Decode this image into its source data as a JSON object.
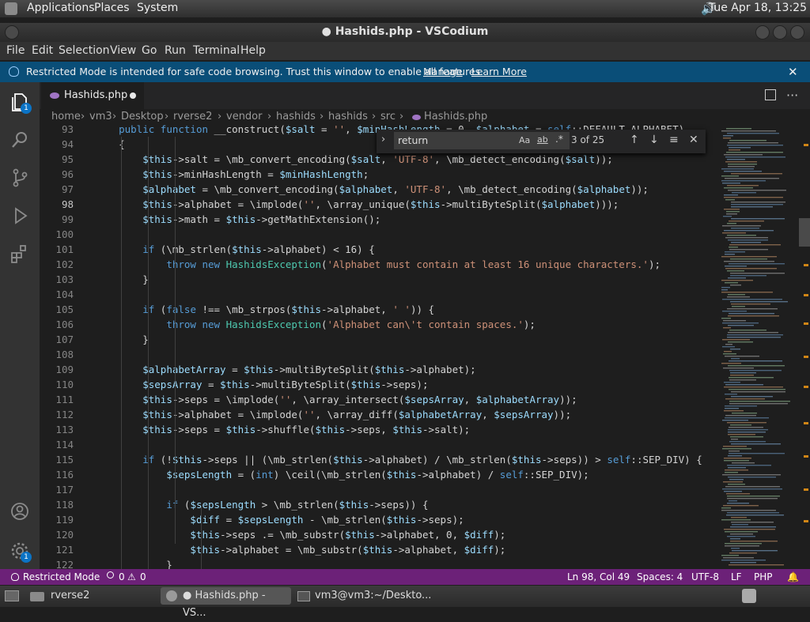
{
  "panel": {
    "applications": "Applications",
    "places": "Places",
    "system": "System",
    "clock": "Tue Apr 18, 13:25"
  },
  "window": {
    "title": "● Hashids.php - VSCodium"
  },
  "menu": [
    "File",
    "Edit",
    "Selection",
    "View",
    "Go",
    "Run",
    "Terminal",
    "Help"
  ],
  "banner": {
    "text": "Restricted Mode is intended for safe code browsing. Trust this window to enable all features.",
    "manage": "Manage",
    "learn_more": "Learn More"
  },
  "tab": {
    "label": "Hashids.php"
  },
  "breadcrumb": [
    "home",
    "vm3",
    "Desktop",
    "rverse2",
    "vendor",
    "hashids",
    "hashids",
    "src",
    "Hashids.php"
  ],
  "find": {
    "value": "return",
    "count": "3 of 25",
    "case": "Aa",
    "word": "ab",
    "regex": ".*"
  },
  "activity_badges": {
    "explorer": "1",
    "settings": "1"
  },
  "code_lines": [
    {
      "n": "93",
      "t": "    public function __construct($salt = '', $minHashLength = 0, $alphabet = self::DEFAULT_ALPHABET)"
    },
    {
      "n": "94",
      "t": "    {"
    },
    {
      "n": "95",
      "t": "        $this->salt = \\mb_convert_encoding($salt, 'UTF-8', \\mb_detect_encoding($salt));"
    },
    {
      "n": "96",
      "t": "        $this->minHashLength = $minHashLength;"
    },
    {
      "n": "97",
      "t": "        $alphabet = \\mb_convert_encoding($alphabet, 'UTF-8', \\mb_detect_encoding($alphabet));"
    },
    {
      "n": "98",
      "t": "        $this->alphabet = \\implode('', \\array_unique($this->multiByteSplit($alphabet)));"
    },
    {
      "n": "99",
      "t": "        $this->math = $this->getMathExtension();"
    },
    {
      "n": "100",
      "t": ""
    },
    {
      "n": "101",
      "t": "        if (\\mb_strlen($this->alphabet) < 16) {"
    },
    {
      "n": "102",
      "t": "            throw new HashidsException('Alphabet must contain at least 16 unique characters.');"
    },
    {
      "n": "103",
      "t": "        }"
    },
    {
      "n": "104",
      "t": ""
    },
    {
      "n": "105",
      "t": "        if (false !== \\mb_strpos($this->alphabet, ' ')) {"
    },
    {
      "n": "106",
      "t": "            throw new HashidsException('Alphabet can\\'t contain spaces.');"
    },
    {
      "n": "107",
      "t": "        }"
    },
    {
      "n": "108",
      "t": ""
    },
    {
      "n": "109",
      "t": "        $alphabetArray = $this->multiByteSplit($this->alphabet);"
    },
    {
      "n": "110",
      "t": "        $sepsArray = $this->multiByteSplit($this->seps);"
    },
    {
      "n": "111",
      "t": "        $this->seps = \\implode('', \\array_intersect($sepsArray, $alphabetArray));"
    },
    {
      "n": "112",
      "t": "        $this->alphabet = \\implode('', \\array_diff($alphabetArray, $sepsArray));"
    },
    {
      "n": "113",
      "t": "        $this->seps = $this->shuffle($this->seps, $this->salt);"
    },
    {
      "n": "114",
      "t": ""
    },
    {
      "n": "115",
      "t": "        if (!$this->seps || (\\mb_strlen($this->alphabet) / \\mb_strlen($this->seps)) > self::SEP_DIV) {"
    },
    {
      "n": "116",
      "t": "            $sepsLength = (int) \\ceil(\\mb_strlen($this->alphabet) / self::SEP_DIV);"
    },
    {
      "n": "117",
      "t": ""
    },
    {
      "n": "118",
      "t": "            if ($sepsLength > \\mb_strlen($this->seps)) {"
    },
    {
      "n": "119",
      "t": "                $diff = $sepsLength - \\mb_strlen($this->seps);"
    },
    {
      "n": "120",
      "t": "                $this->seps .= \\mb_substr($this->alphabet, 0, $diff);"
    },
    {
      "n": "121",
      "t": "                $this->alphabet = \\mb_substr($this->alphabet, $diff);"
    },
    {
      "n": "122",
      "t": "            }"
    }
  ],
  "status": {
    "mode": "Restricted Mode",
    "errors": "0",
    "warnings": "0",
    "position": "Ln 98, Col 49",
    "spaces": "Spaces: 4",
    "encoding": "UTF-8",
    "eol": "LF",
    "language": "PHP"
  },
  "taskbar": {
    "folder": "rverse2",
    "editor": "● Hashids.php - VS...",
    "terminal": "vm3@vm3:~/Deskto..."
  },
  "colors": {
    "statusbar": "#6c2178",
    "banner": "#0a4e78",
    "variable": "#9cdcfe",
    "string": "#ce9178",
    "keyword": "#569cd6",
    "class": "#4ec9b0"
  }
}
